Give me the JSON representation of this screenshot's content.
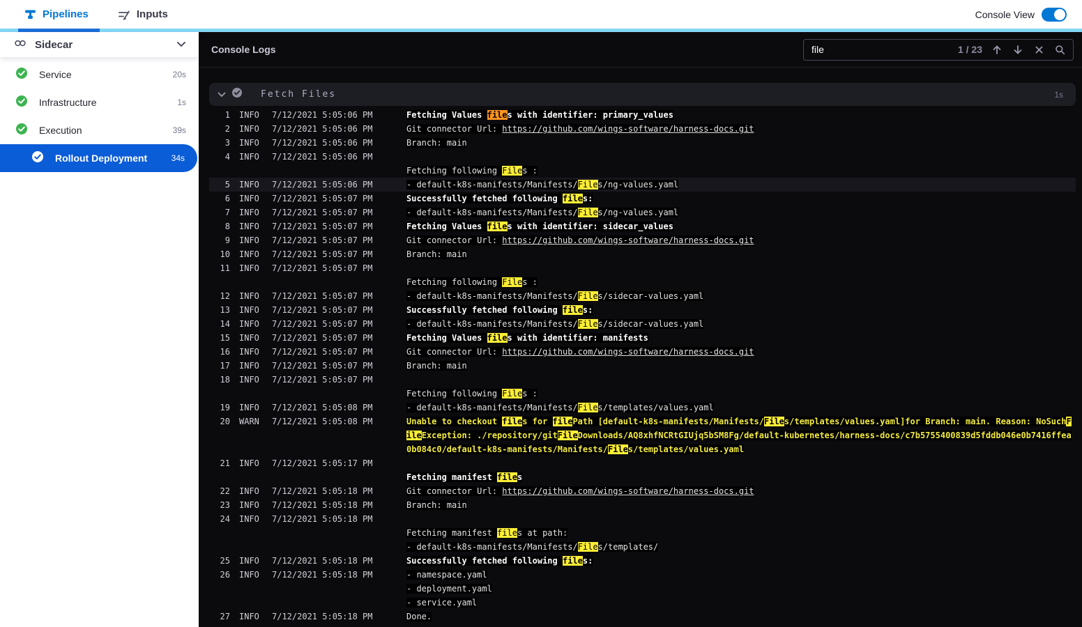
{
  "colors": {
    "accent_blue": "#0278d5",
    "selected_blue": "#0b5cd7",
    "success_green": "#3cb450",
    "match_yellow": "#fdee35",
    "active_match_orange": "#ff941f",
    "warn_text": "#f1e943",
    "tabline_light": "#85d6f5"
  },
  "icons": {
    "tab_pipelines": "pipeline-icon",
    "tab_inputs": "edit-inputs-icon",
    "stage": "link-icon",
    "expand": "chevron-down-icon",
    "step_status": "check-circle-icon",
    "search": "magnifier-icon",
    "search_prev": "arrow-up-icon",
    "search_next": "arrow-down-icon",
    "search_clear": "close-icon"
  },
  "topbar": {
    "tabs": [
      {
        "label": "Pipelines",
        "active": true
      },
      {
        "label": "Inputs",
        "active": false
      }
    ],
    "console_view_label": "Console View",
    "console_view_on": true
  },
  "sidebar": {
    "stage_label": "Sidecar",
    "items": [
      {
        "label": "Service",
        "duration": "20s",
        "status": "success",
        "selected": false,
        "indent": false
      },
      {
        "label": "Infrastructure",
        "duration": "1s",
        "status": "success",
        "selected": false,
        "indent": false
      },
      {
        "label": "Execution",
        "duration": "39s",
        "status": "success",
        "selected": false,
        "indent": false
      },
      {
        "label": "Rollout Deployment",
        "duration": "34s",
        "status": "success",
        "selected": true,
        "indent": true
      }
    ]
  },
  "console": {
    "title": "Console Logs",
    "search": {
      "value": "file",
      "counter": "1 / 23"
    },
    "section": {
      "title": "Fetch Files",
      "duration": "1s"
    },
    "logs": [
      {
        "n": "1",
        "lv": "INFO",
        "ts": "7/12/2021 5:05:06 PM",
        "rows": [
          {
            "b": true,
            "segs": [
              {
                "t": "Fetching Values "
              },
              {
                "t": "file",
                "h": "a"
              },
              {
                "t": "s with identifier: primary_values"
              }
            ]
          }
        ]
      },
      {
        "n": "2",
        "lv": "INFO",
        "ts": "7/12/2021 5:05:06 PM",
        "rows": [
          {
            "segs": [
              {
                "t": "Git connector Url: "
              },
              {
                "t": "https://github.com/wings-software/harness-docs.git",
                "link": true
              }
            ]
          }
        ]
      },
      {
        "n": "3",
        "lv": "INFO",
        "ts": "7/12/2021 5:05:06 PM",
        "rows": [
          {
            "segs": [
              {
                "t": "Branch: main"
              }
            ]
          }
        ]
      },
      {
        "n": "4",
        "lv": "INFO",
        "ts": "7/12/2021 5:05:06 PM",
        "rows": [
          {
            "segs": []
          },
          {
            "segs": [
              {
                "t": "Fetching following "
              },
              {
                "t": "File",
                "h": "m"
              },
              {
                "t": "s :"
              }
            ]
          }
        ]
      },
      {
        "n": "5",
        "lv": "INFO",
        "ts": "7/12/2021 5:05:06 PM",
        "hl": true,
        "rows": [
          {
            "segs": [
              {
                "t": "- default-k8s-manifests/Manifests/"
              },
              {
                "t": "File",
                "h": "m"
              },
              {
                "t": "s/ng-values.yaml"
              }
            ]
          }
        ]
      },
      {
        "n": "6",
        "lv": "INFO",
        "ts": "7/12/2021 5:05:07 PM",
        "rows": [
          {
            "b": true,
            "segs": [
              {
                "t": "Successfully fetched following "
              },
              {
                "t": "file",
                "h": "m"
              },
              {
                "t": "s:"
              }
            ]
          }
        ]
      },
      {
        "n": "7",
        "lv": "INFO",
        "ts": "7/12/2021 5:05:07 PM",
        "rows": [
          {
            "segs": [
              {
                "t": "- default-k8s-manifests/Manifests/"
              },
              {
                "t": "File",
                "h": "m"
              },
              {
                "t": "s/ng-values.yaml"
              }
            ]
          }
        ]
      },
      {
        "n": "8",
        "lv": "INFO",
        "ts": "7/12/2021 5:05:07 PM",
        "rows": [
          {
            "b": true,
            "segs": [
              {
                "t": "Fetching Values "
              },
              {
                "t": "file",
                "h": "m"
              },
              {
                "t": "s with identifier: sidecar_values"
              }
            ]
          }
        ]
      },
      {
        "n": "9",
        "lv": "INFO",
        "ts": "7/12/2021 5:05:07 PM",
        "rows": [
          {
            "segs": [
              {
                "t": "Git connector Url: "
              },
              {
                "t": "https://github.com/wings-software/harness-docs.git",
                "link": true
              }
            ]
          }
        ]
      },
      {
        "n": "10",
        "lv": "INFO",
        "ts": "7/12/2021 5:05:07 PM",
        "rows": [
          {
            "segs": [
              {
                "t": "Branch: main"
              }
            ]
          }
        ]
      },
      {
        "n": "11",
        "lv": "INFO",
        "ts": "7/12/2021 5:05:07 PM",
        "rows": [
          {
            "segs": []
          },
          {
            "segs": [
              {
                "t": "Fetching following "
              },
              {
                "t": "File",
                "h": "m"
              },
              {
                "t": "s :"
              }
            ]
          }
        ]
      },
      {
        "n": "12",
        "lv": "INFO",
        "ts": "7/12/2021 5:05:07 PM",
        "rows": [
          {
            "segs": [
              {
                "t": "- default-k8s-manifests/Manifests/"
              },
              {
                "t": "File",
                "h": "m"
              },
              {
                "t": "s/sidecar-values.yaml"
              }
            ]
          }
        ]
      },
      {
        "n": "13",
        "lv": "INFO",
        "ts": "7/12/2021 5:05:07 PM",
        "rows": [
          {
            "b": true,
            "segs": [
              {
                "t": "Successfully fetched following "
              },
              {
                "t": "file",
                "h": "m"
              },
              {
                "t": "s:"
              }
            ]
          }
        ]
      },
      {
        "n": "14",
        "lv": "INFO",
        "ts": "7/12/2021 5:05:07 PM",
        "rows": [
          {
            "segs": [
              {
                "t": "- default-k8s-manifests/Manifests/"
              },
              {
                "t": "File",
                "h": "m"
              },
              {
                "t": "s/sidecar-values.yaml"
              }
            ]
          }
        ]
      },
      {
        "n": "15",
        "lv": "INFO",
        "ts": "7/12/2021 5:05:07 PM",
        "rows": [
          {
            "b": true,
            "segs": [
              {
                "t": "Fetching Values "
              },
              {
                "t": "file",
                "h": "m"
              },
              {
                "t": "s with identifier: manifests"
              }
            ]
          }
        ]
      },
      {
        "n": "16",
        "lv": "INFO",
        "ts": "7/12/2021 5:05:07 PM",
        "rows": [
          {
            "segs": [
              {
                "t": "Git connector Url: "
              },
              {
                "t": "https://github.com/wings-software/harness-docs.git",
                "link": true
              }
            ]
          }
        ]
      },
      {
        "n": "17",
        "lv": "INFO",
        "ts": "7/12/2021 5:05:07 PM",
        "rows": [
          {
            "segs": [
              {
                "t": "Branch: main"
              }
            ]
          }
        ]
      },
      {
        "n": "18",
        "lv": "INFO",
        "ts": "7/12/2021 5:05:07 PM",
        "rows": [
          {
            "segs": []
          },
          {
            "segs": [
              {
                "t": "Fetching following "
              },
              {
                "t": "File",
                "h": "m"
              },
              {
                "t": "s :"
              }
            ]
          }
        ]
      },
      {
        "n": "19",
        "lv": "INFO",
        "ts": "7/12/2021 5:05:08 PM",
        "rows": [
          {
            "segs": [
              {
                "t": "- default-k8s-manifests/Manifests/"
              },
              {
                "t": "File",
                "h": "m"
              },
              {
                "t": "s/templates/values.yaml"
              }
            ]
          }
        ]
      },
      {
        "n": "20",
        "lv": "WARN",
        "ts": "7/12/2021 5:05:08 PM",
        "rows": [
          {
            "w": true,
            "segs": [
              {
                "t": "Unable to checkout "
              },
              {
                "t": "file",
                "h": "m"
              },
              {
                "t": "s for "
              },
              {
                "t": "file",
                "h": "m"
              },
              {
                "t": "Path [default-k8s-manifests/Manifests/"
              },
              {
                "t": "File",
                "h": "m"
              },
              {
                "t": "s/templates/values.yaml]for Branch: main. Reason: NoSuch"
              },
              {
                "t": "F",
                "h": "m"
              }
            ]
          },
          {
            "w": true,
            "segs": [
              {
                "t": "ile",
                "h": "m"
              },
              {
                "t": "Exception: ./repository/git"
              },
              {
                "t": "File",
                "h": "m"
              },
              {
                "t": "Downloads/AQ8xhfNCRtGIUjq5bSM8Fg/default-kubernetes/harness-docs/c7b5755400839d5fddb046e0b7416ffea"
              }
            ]
          },
          {
            "w": true,
            "segs": [
              {
                "t": "0b084c0/default-k8s-manifests/Manifests/"
              },
              {
                "t": "File",
                "h": "m"
              },
              {
                "t": "s/templates/values.yaml"
              }
            ]
          }
        ]
      },
      {
        "n": "21",
        "lv": "INFO",
        "ts": "7/12/2021 5:05:17 PM",
        "rows": [
          {
            "segs": []
          },
          {
            "b": true,
            "segs": [
              {
                "t": "Fetching manifest "
              },
              {
                "t": "file",
                "h": "m"
              },
              {
                "t": "s"
              }
            ]
          }
        ]
      },
      {
        "n": "22",
        "lv": "INFO",
        "ts": "7/12/2021 5:05:18 PM",
        "rows": [
          {
            "segs": [
              {
                "t": "Git connector Url: "
              },
              {
                "t": "https://github.com/wings-software/harness-docs.git",
                "link": true
              }
            ]
          }
        ]
      },
      {
        "n": "23",
        "lv": "INFO",
        "ts": "7/12/2021 5:05:18 PM",
        "rows": [
          {
            "segs": [
              {
                "t": "Branch: main"
              }
            ]
          }
        ]
      },
      {
        "n": "24",
        "lv": "INFO",
        "ts": "7/12/2021 5:05:18 PM",
        "rows": [
          {
            "segs": []
          },
          {
            "segs": [
              {
                "t": "Fetching manifest "
              },
              {
                "t": "file",
                "h": "m"
              },
              {
                "t": "s at path:"
              }
            ]
          },
          {
            "segs": [
              {
                "t": "- default-k8s-manifests/Manifests/"
              },
              {
                "t": "File",
                "h": "m"
              },
              {
                "t": "s/templates/"
              }
            ]
          }
        ]
      },
      {
        "n": "25",
        "lv": "INFO",
        "ts": "7/12/2021 5:05:18 PM",
        "rows": [
          {
            "b": true,
            "segs": [
              {
                "t": "Successfully fetched following "
              },
              {
                "t": "file",
                "h": "m"
              },
              {
                "t": "s:"
              }
            ]
          }
        ]
      },
      {
        "n": "26",
        "lv": "INFO",
        "ts": "7/12/2021 5:05:18 PM",
        "rows": [
          {
            "segs": [
              {
                "t": "- namespace.yaml"
              }
            ]
          },
          {
            "segs": [
              {
                "t": "- deployment.yaml"
              }
            ]
          },
          {
            "segs": [
              {
                "t": "- service.yaml"
              }
            ]
          }
        ]
      },
      {
        "n": "27",
        "lv": "INFO",
        "ts": "7/12/2021 5:05:18 PM",
        "rows": [
          {
            "segs": [
              {
                "t": "Done."
              }
            ]
          }
        ]
      }
    ]
  }
}
